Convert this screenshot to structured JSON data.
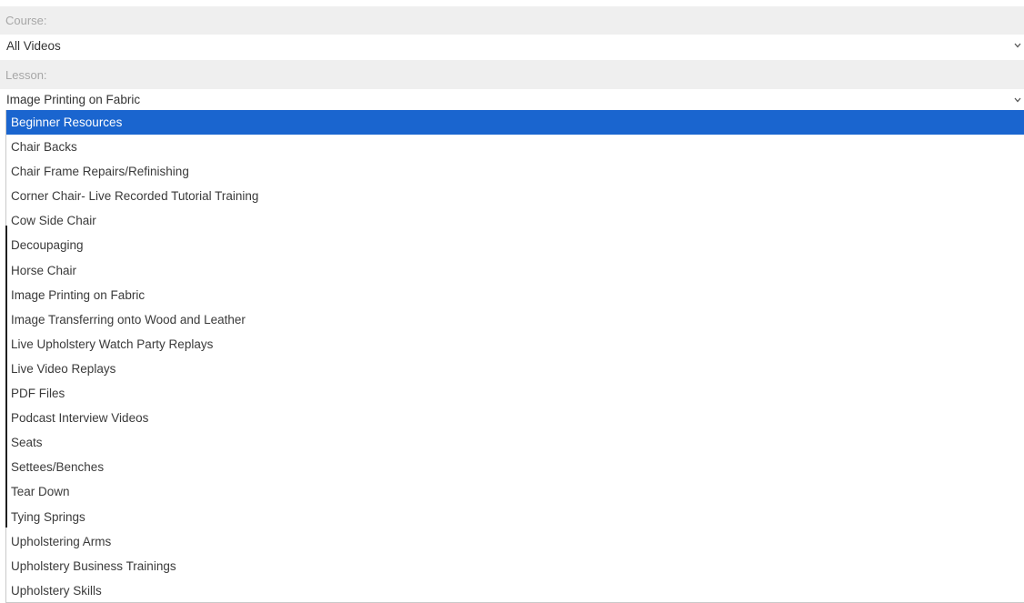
{
  "course": {
    "label": "Course:",
    "value": "All Videos"
  },
  "lesson": {
    "label": "Lesson:",
    "value": "Image Printing on Fabric",
    "options": [
      "Beginner Resources",
      "Chair Backs",
      "Chair Frame Repairs/Refinishing",
      "Corner Chair- Live Recorded Tutorial Training",
      "Cow Side Chair",
      "Decoupaging",
      "Horse Chair",
      "Image Printing on Fabric",
      "Image Transferring onto Wood and Leather",
      "Live Upholstery Watch Party Replays",
      "Live Video Replays",
      "PDF Files",
      "Podcast Interview Videos",
      "Seats",
      "Settees/Benches",
      "Tear Down",
      "Tying Springs",
      "Upholstering Arms",
      "Upholstery Business Trainings",
      "Upholstery Skills"
    ],
    "highlighted_option": "Beginner Resources"
  },
  "icons": {
    "select_arrow": "chevron-down-icon"
  },
  "colors": {
    "highlight": "#1a65cf",
    "label_bar": "#efefef",
    "label_text": "#a7a7a7"
  }
}
